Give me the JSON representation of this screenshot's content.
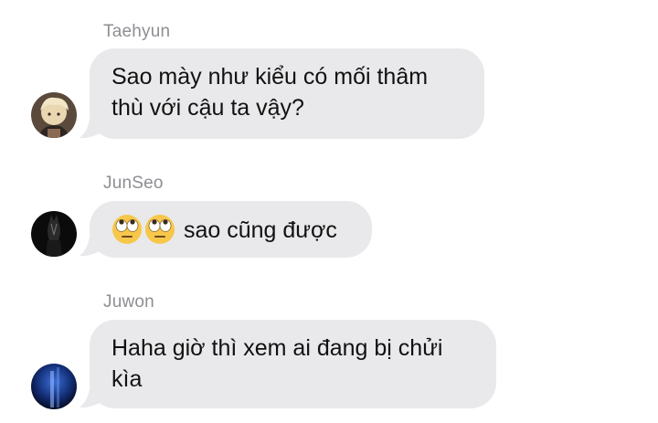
{
  "messages": [
    {
      "sender": "Taehyun",
      "text": "Sao mày như kiểu có mối thâm thù với cậu ta vậy?",
      "avatar_icon": "avatar-photo-light-hair"
    },
    {
      "sender": "JunSeo",
      "emoji": [
        "face-with-rolling-eyes",
        "face-with-rolling-eyes"
      ],
      "text": "sao cũng được",
      "avatar_icon": "avatar-photo-dark"
    },
    {
      "sender": "Juwon",
      "text": "Haha giờ thì xem ai đang bị chửi kìa",
      "avatar_icon": "avatar-photo-blue-light"
    }
  ],
  "colors": {
    "bubble": "#e9e9eb",
    "sender_name": "#8e8e93",
    "text": "#111111"
  }
}
